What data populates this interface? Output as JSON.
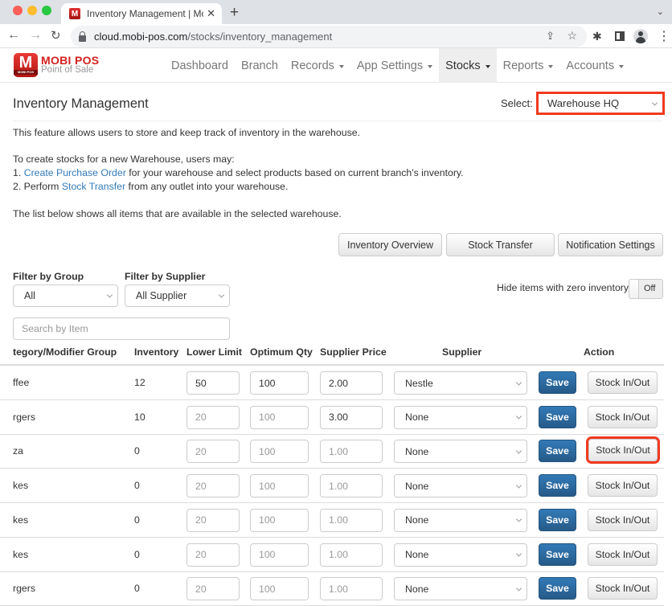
{
  "browser": {
    "tab_title": "Inventory Management | MobiPOS",
    "favicon_letter": "M",
    "close_glyph": "✕",
    "newtab_glyph": "+",
    "tabs_menu_glyph": "⌄",
    "back_glyph": "←",
    "forward_glyph": "→",
    "reload_glyph": "↻",
    "url_host": "cloud.mobi-pos.com",
    "url_path": "/stocks/inventory_management",
    "share_glyph": "⇪",
    "star_glyph": "☆",
    "extensions_glyph": "✱",
    "menu_glyph": "⋮"
  },
  "app": {
    "logo": {
      "mark_letter": "M",
      "mark_sub": "MOBI POS",
      "brand": "MOBI POS",
      "tagline": "Point of Sale",
      "brand_color": "#d3211f"
    },
    "menu": [
      {
        "label": "Dashboard",
        "dropdown": false,
        "active": false
      },
      {
        "label": "Branch",
        "dropdown": false,
        "active": false
      },
      {
        "label": "Records",
        "dropdown": true,
        "active": false
      },
      {
        "label": "App Settings",
        "dropdown": true,
        "active": false
      },
      {
        "label": "Stocks",
        "dropdown": true,
        "active": true
      },
      {
        "label": "Reports",
        "dropdown": true,
        "active": false
      },
      {
        "label": "Accounts",
        "dropdown": true,
        "active": false
      }
    ]
  },
  "page": {
    "title": "Inventory Management",
    "select_label": "Select:",
    "warehouse_selected": "Warehouse HQ",
    "highlight_color": "#f03a1f",
    "description": {
      "line1": "This feature allows users to store and keep track of inventory in the warehouse.",
      "line2": "To create stocks for a new Warehouse, users may:",
      "step1_prefix": "1. ",
      "step1_link": "Create Purchase Order",
      "step1_rest": " for your warehouse and select products based on current branch's inventory.",
      "step2_prefix": "2. Perform ",
      "step2_link": "Stock Transfer",
      "step2_rest": " from any outlet into your warehouse.",
      "line3": "The list below shows all items that are available in the selected warehouse."
    },
    "buttons": {
      "inventory_overview": "Inventory Overview",
      "stock_transfer": "Stock Transfer",
      "notification_settings": "Notification Settings"
    },
    "filters": {
      "group_label": "Filter by Group",
      "group_value": "All",
      "supplier_label": "Filter by Supplier",
      "supplier_value": "All Supplier",
      "search_placeholder": "Search by Item",
      "hide_zero_label": "Hide items with zero inventory",
      "hide_zero_state": "Off"
    },
    "table": {
      "headers": {
        "category": "tegory/Modifier Group",
        "inventory": "Inventory",
        "lower_limit": "Lower Limit",
        "optimum_qty": "Optimum Qty",
        "supplier_price": "Supplier Price",
        "supplier": "Supplier",
        "action": "Action"
      },
      "save_label": "Save",
      "stock_io_label": "Stock In/Out",
      "rows": [
        {
          "category": "ffee",
          "inventory": "12",
          "lower_limit": "50",
          "optimum_qty": "100",
          "supplier_price": "2.00",
          "supplier": "Nestle",
          "ll_muted": false,
          "oq_muted": false,
          "sp_muted": false,
          "highlight": false
        },
        {
          "category": "rgers",
          "inventory": "10",
          "lower_limit": "20",
          "optimum_qty": "100",
          "supplier_price": "3.00",
          "supplier": "None",
          "ll_muted": true,
          "oq_muted": true,
          "sp_muted": false,
          "highlight": false
        },
        {
          "category": "za",
          "inventory": "0",
          "lower_limit": "20",
          "optimum_qty": "100",
          "supplier_price": "1.00",
          "supplier": "None",
          "ll_muted": true,
          "oq_muted": true,
          "sp_muted": true,
          "highlight": true
        },
        {
          "category": "kes",
          "inventory": "0",
          "lower_limit": "20",
          "optimum_qty": "100",
          "supplier_price": "1.00",
          "supplier": "None",
          "ll_muted": true,
          "oq_muted": true,
          "sp_muted": true,
          "highlight": false
        },
        {
          "category": "kes",
          "inventory": "0",
          "lower_limit": "20",
          "optimum_qty": "100",
          "supplier_price": "1.00",
          "supplier": "None",
          "ll_muted": true,
          "oq_muted": true,
          "sp_muted": true,
          "highlight": false
        },
        {
          "category": "kes",
          "inventory": "0",
          "lower_limit": "20",
          "optimum_qty": "100",
          "supplier_price": "1.00",
          "supplier": "None",
          "ll_muted": true,
          "oq_muted": true,
          "sp_muted": true,
          "highlight": false
        },
        {
          "category": "rgers",
          "inventory": "0",
          "lower_limit": "20",
          "optimum_qty": "100",
          "supplier_price": "1.00",
          "supplier": "None",
          "ll_muted": true,
          "oq_muted": true,
          "sp_muted": true,
          "highlight": false
        }
      ]
    }
  }
}
